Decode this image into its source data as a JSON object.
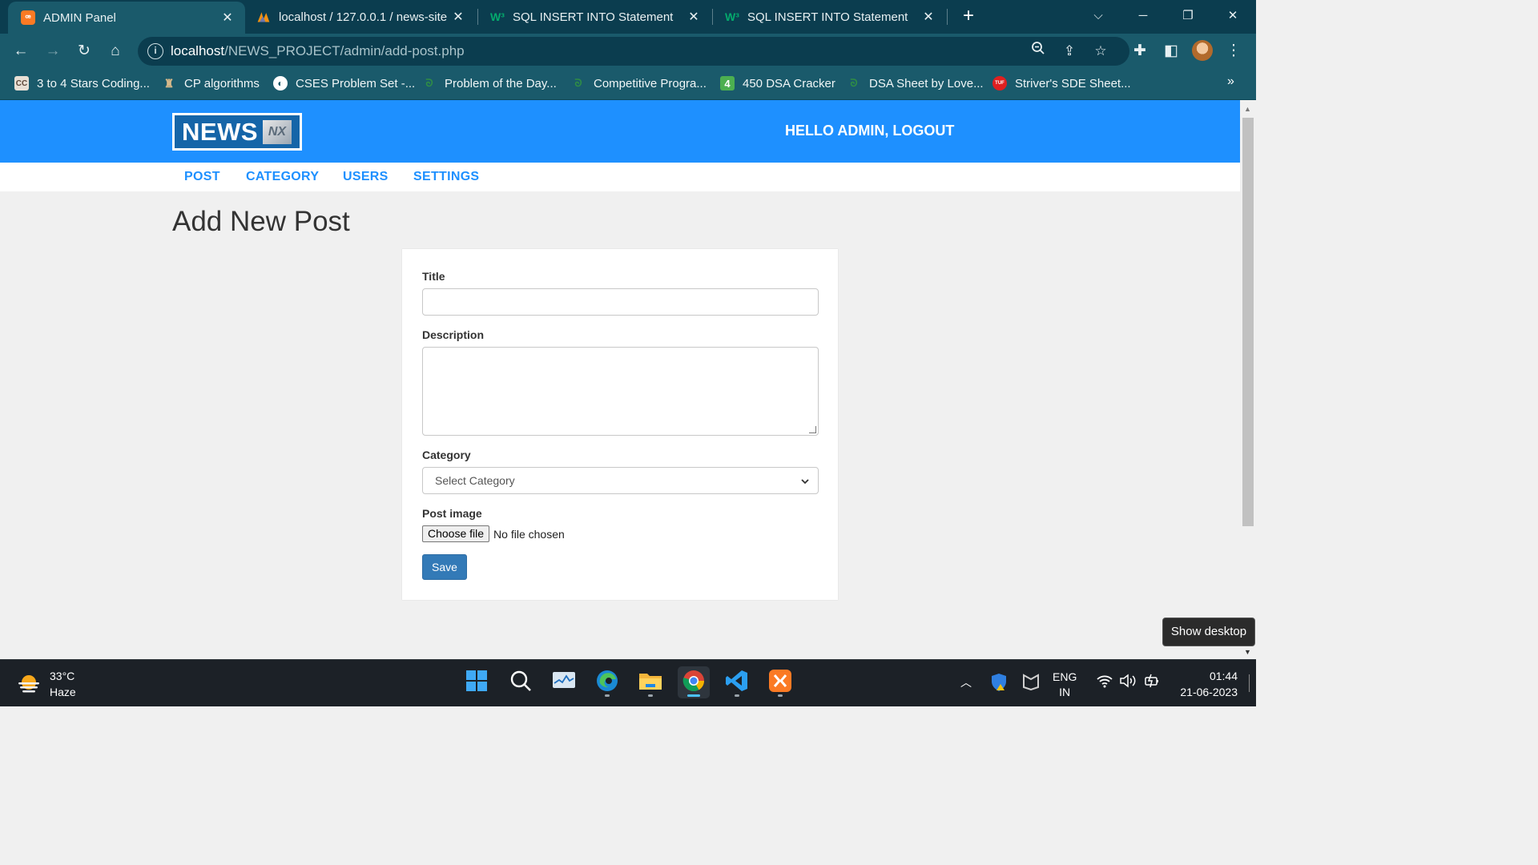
{
  "browser": {
    "tabs": [
      {
        "title": "ADMIN Panel",
        "icon": "xampp-icon",
        "active": true
      },
      {
        "title": "localhost / 127.0.0.1 / news-site / ...",
        "icon": "phpmyadmin-icon",
        "active": false
      },
      {
        "title": "SQL INSERT INTO Statement",
        "icon": "w3schools-icon",
        "active": false
      },
      {
        "title": "SQL INSERT INTO Statement",
        "icon": "w3schools-icon",
        "active": false
      }
    ],
    "address": {
      "host": "localhost",
      "path": "/NEWS_PROJECT/admin/add-post.php"
    },
    "bookmarks": [
      {
        "label": "3 to 4 Stars Coding...",
        "icon": "codechef-icon"
      },
      {
        "label": "CP algorithms",
        "icon": "cp-algorithms-icon"
      },
      {
        "label": "CSES Problem Set -...",
        "icon": "cses-icon"
      },
      {
        "label": "Problem of the Day...",
        "icon": "geeksforgeeks-icon"
      },
      {
        "label": "Competitive Progra...",
        "icon": "geeksforgeeks-icon"
      },
      {
        "label": "450 DSA Cracker",
        "icon": "dsa-cracker-icon"
      },
      {
        "label": "DSA Sheet by Love...",
        "icon": "geeksforgeeks-icon"
      },
      {
        "label": "Striver's SDE Sheet...",
        "icon": "takeuforward-icon"
      }
    ]
  },
  "header": {
    "logo_text": "NEWS",
    "logo_mark": "NX",
    "greeting": "HELLO ADMIN, LOGOUT"
  },
  "menu": {
    "post": "POST",
    "category": "CATEGORY",
    "users": "USERS",
    "settings": "SETTINGS"
  },
  "page": {
    "title": "Add New Post"
  },
  "form": {
    "title_label": "Title",
    "title_value": "",
    "description_label": "Description",
    "description_value": "",
    "category_label": "Category",
    "category_selected": "Select Category",
    "image_label": "Post image",
    "choose_file": "Choose file",
    "file_status": "No file chosen",
    "save": "Save"
  },
  "tooltip": "Show desktop",
  "taskbar": {
    "weather_temp": "33°C",
    "weather_desc": "Haze",
    "lang_1": "ENG",
    "lang_2": "IN",
    "time": "01:44",
    "date": "21-06-2023"
  },
  "colors": {
    "header_bg": "#1e90ff",
    "menu_link": "#1e90ff",
    "save_button": "#337ab7",
    "browser_frame": "#0b3d4f"
  }
}
